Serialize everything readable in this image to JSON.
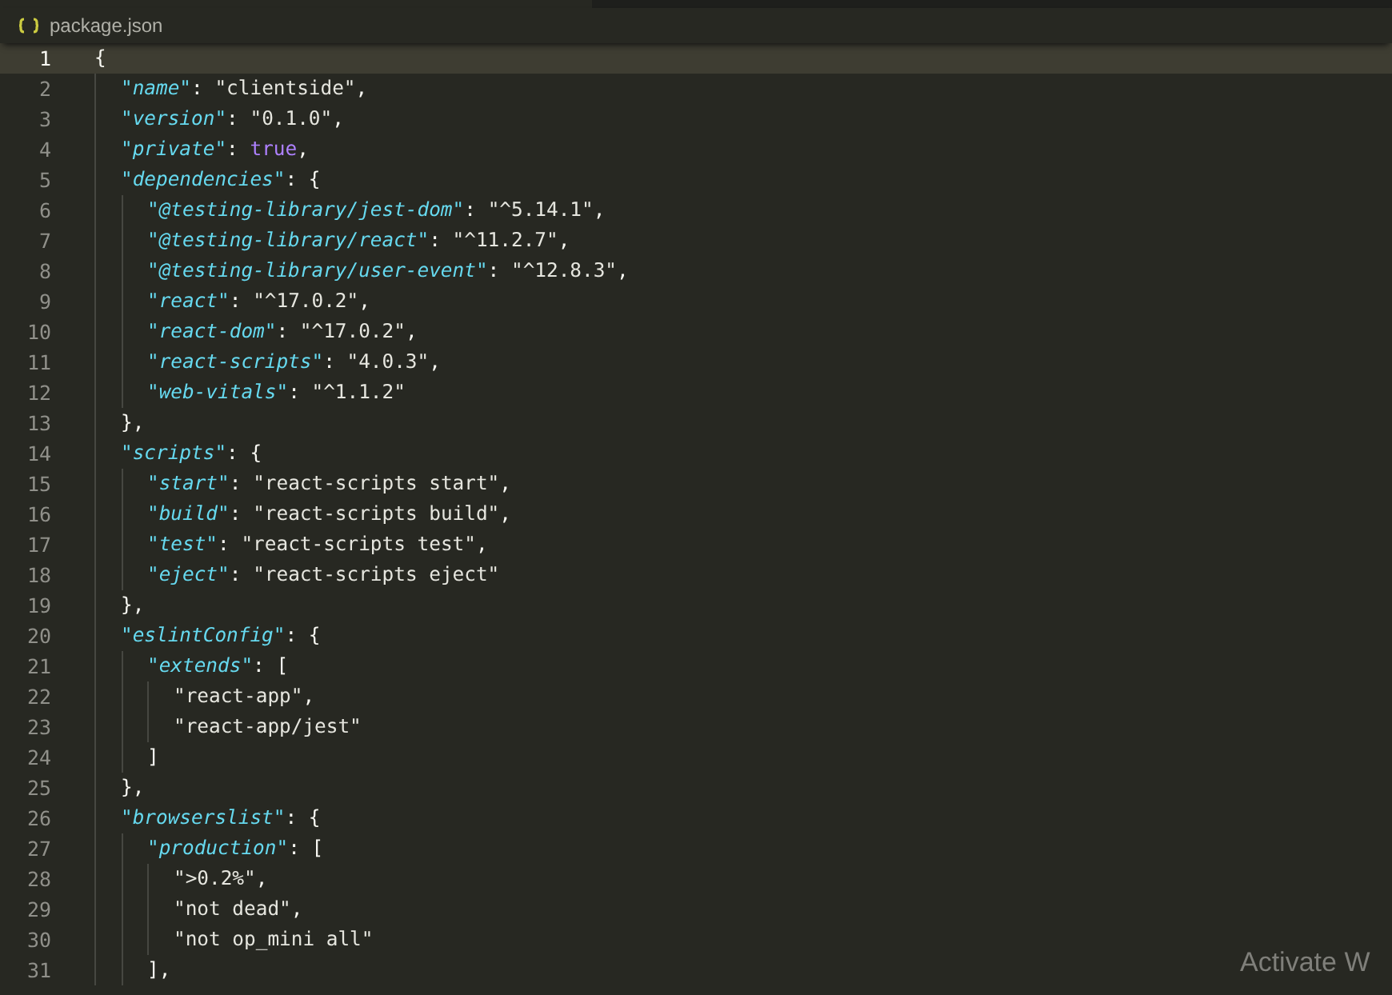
{
  "breadcrumb": {
    "file": "package.json"
  },
  "lines": [
    {
      "number": "1",
      "current": true,
      "tokens": [
        {
          "kind": "punct",
          "text": "{"
        }
      ],
      "children": [
        {
          "number": "2",
          "current": false,
          "tokens": [
            {
              "kind": "key",
              "text": "\"name\""
            },
            {
              "kind": "punct",
              "text": ": "
            },
            {
              "kind": "string",
              "text": "\"clientside\""
            },
            {
              "kind": "punct",
              "text": ","
            }
          ]
        },
        {
          "number": "3",
          "current": false,
          "tokens": [
            {
              "kind": "key",
              "text": "\"version\""
            },
            {
              "kind": "punct",
              "text": ": "
            },
            {
              "kind": "string",
              "text": "\"0.1.0\""
            },
            {
              "kind": "punct",
              "text": ","
            }
          ]
        },
        {
          "number": "4",
          "current": false,
          "tokens": [
            {
              "kind": "key",
              "text": "\"private\""
            },
            {
              "kind": "punct",
              "text": ": "
            },
            {
              "kind": "literal",
              "text": "true"
            },
            {
              "kind": "punct",
              "text": ","
            }
          ]
        },
        {
          "number": "5",
          "current": false,
          "tokens": [
            {
              "kind": "key",
              "text": "\"dependencies\""
            },
            {
              "kind": "punct",
              "text": ": {"
            }
          ],
          "children": [
            {
              "number": "6",
              "current": false,
              "tokens": [
                {
                  "kind": "key",
                  "text": "\"@testing-library/jest-dom\""
                },
                {
                  "kind": "punct",
                  "text": ": "
                },
                {
                  "kind": "string",
                  "text": "\"^5.14.1\""
                },
                {
                  "kind": "punct",
                  "text": ","
                }
              ]
            },
            {
              "number": "7",
              "current": false,
              "tokens": [
                {
                  "kind": "key",
                  "text": "\"@testing-library/react\""
                },
                {
                  "kind": "punct",
                  "text": ": "
                },
                {
                  "kind": "string",
                  "text": "\"^11.2.7\""
                },
                {
                  "kind": "punct",
                  "text": ","
                }
              ]
            },
            {
              "number": "8",
              "current": false,
              "tokens": [
                {
                  "kind": "key",
                  "text": "\"@testing-library/user-event\""
                },
                {
                  "kind": "punct",
                  "text": ": "
                },
                {
                  "kind": "string",
                  "text": "\"^12.8.3\""
                },
                {
                  "kind": "punct",
                  "text": ","
                }
              ]
            },
            {
              "number": "9",
              "current": false,
              "tokens": [
                {
                  "kind": "key",
                  "text": "\"react\""
                },
                {
                  "kind": "punct",
                  "text": ": "
                },
                {
                  "kind": "string",
                  "text": "\"^17.0.2\""
                },
                {
                  "kind": "punct",
                  "text": ","
                }
              ]
            },
            {
              "number": "10",
              "current": false,
              "tokens": [
                {
                  "kind": "key",
                  "text": "\"react-dom\""
                },
                {
                  "kind": "punct",
                  "text": ": "
                },
                {
                  "kind": "string",
                  "text": "\"^17.0.2\""
                },
                {
                  "kind": "punct",
                  "text": ","
                }
              ]
            },
            {
              "number": "11",
              "current": false,
              "tokens": [
                {
                  "kind": "key",
                  "text": "\"react-scripts\""
                },
                {
                  "kind": "punct",
                  "text": ": "
                },
                {
                  "kind": "string",
                  "text": "\"4.0.3\""
                },
                {
                  "kind": "punct",
                  "text": ","
                }
              ]
            },
            {
              "number": "12",
              "current": false,
              "tokens": [
                {
                  "kind": "key",
                  "text": "\"web-vitals\""
                },
                {
                  "kind": "punct",
                  "text": ": "
                },
                {
                  "kind": "string",
                  "text": "\"^1.1.2\""
                }
              ]
            }
          ]
        },
        {
          "number": "13",
          "current": false,
          "tokens": [
            {
              "kind": "punct",
              "text": "},"
            }
          ]
        },
        {
          "number": "14",
          "current": false,
          "tokens": [
            {
              "kind": "key",
              "text": "\"scripts\""
            },
            {
              "kind": "punct",
              "text": ": {"
            }
          ],
          "children": [
            {
              "number": "15",
              "current": false,
              "tokens": [
                {
                  "kind": "key",
                  "text": "\"start\""
                },
                {
                  "kind": "punct",
                  "text": ": "
                },
                {
                  "kind": "string",
                  "text": "\"react-scripts start\""
                },
                {
                  "kind": "punct",
                  "text": ","
                }
              ]
            },
            {
              "number": "16",
              "current": false,
              "tokens": [
                {
                  "kind": "key",
                  "text": "\"build\""
                },
                {
                  "kind": "punct",
                  "text": ": "
                },
                {
                  "kind": "string",
                  "text": "\"react-scripts build\""
                },
                {
                  "kind": "punct",
                  "text": ","
                }
              ]
            },
            {
              "number": "17",
              "current": false,
              "tokens": [
                {
                  "kind": "key",
                  "text": "\"test\""
                },
                {
                  "kind": "punct",
                  "text": ": "
                },
                {
                  "kind": "string",
                  "text": "\"react-scripts test\""
                },
                {
                  "kind": "punct",
                  "text": ","
                }
              ]
            },
            {
              "number": "18",
              "current": false,
              "tokens": [
                {
                  "kind": "key",
                  "text": "\"eject\""
                },
                {
                  "kind": "punct",
                  "text": ": "
                },
                {
                  "kind": "string",
                  "text": "\"react-scripts eject\""
                }
              ]
            }
          ]
        },
        {
          "number": "19",
          "current": false,
          "tokens": [
            {
              "kind": "punct",
              "text": "},"
            }
          ]
        },
        {
          "number": "20",
          "current": false,
          "tokens": [
            {
              "kind": "key",
              "text": "\"eslintConfig\""
            },
            {
              "kind": "punct",
              "text": ": {"
            }
          ],
          "children": [
            {
              "number": "21",
              "current": false,
              "tokens": [
                {
                  "kind": "key",
                  "text": "\"extends\""
                },
                {
                  "kind": "punct",
                  "text": ": ["
                }
              ],
              "children": [
                {
                  "number": "22",
                  "current": false,
                  "tokens": [
                    {
                      "kind": "string",
                      "text": "\"react-app\""
                    },
                    {
                      "kind": "punct",
                      "text": ","
                    }
                  ]
                },
                {
                  "number": "23",
                  "current": false,
                  "tokens": [
                    {
                      "kind": "string",
                      "text": "\"react-app/jest\""
                    }
                  ]
                }
              ]
            },
            {
              "number": "24",
              "current": false,
              "tokens": [
                {
                  "kind": "punct",
                  "text": "]"
                }
              ]
            }
          ]
        },
        {
          "number": "25",
          "current": false,
          "tokens": [
            {
              "kind": "punct",
              "text": "},"
            }
          ]
        },
        {
          "number": "26",
          "current": false,
          "tokens": [
            {
              "kind": "key",
              "text": "\"browserslist\""
            },
            {
              "kind": "punct",
              "text": ": {"
            }
          ],
          "children": [
            {
              "number": "27",
              "current": false,
              "tokens": [
                {
                  "kind": "key",
                  "text": "\"production\""
                },
                {
                  "kind": "punct",
                  "text": ": ["
                }
              ],
              "children": [
                {
                  "number": "28",
                  "current": false,
                  "tokens": [
                    {
                      "kind": "string",
                      "text": "\">0.2%\""
                    },
                    {
                      "kind": "punct",
                      "text": ","
                    }
                  ]
                },
                {
                  "number": "29",
                  "current": false,
                  "tokens": [
                    {
                      "kind": "string",
                      "text": "\"not dead\""
                    },
                    {
                      "kind": "punct",
                      "text": ","
                    }
                  ]
                },
                {
                  "number": "30",
                  "current": false,
                  "tokens": [
                    {
                      "kind": "string",
                      "text": "\"not op_mini all\""
                    }
                  ]
                }
              ]
            },
            {
              "number": "31",
              "current": false,
              "tokens": [
                {
                  "kind": "punct",
                  "text": "],"
                }
              ]
            }
          ]
        }
      ]
    }
  ],
  "overlay": {
    "text": "Activate W"
  }
}
